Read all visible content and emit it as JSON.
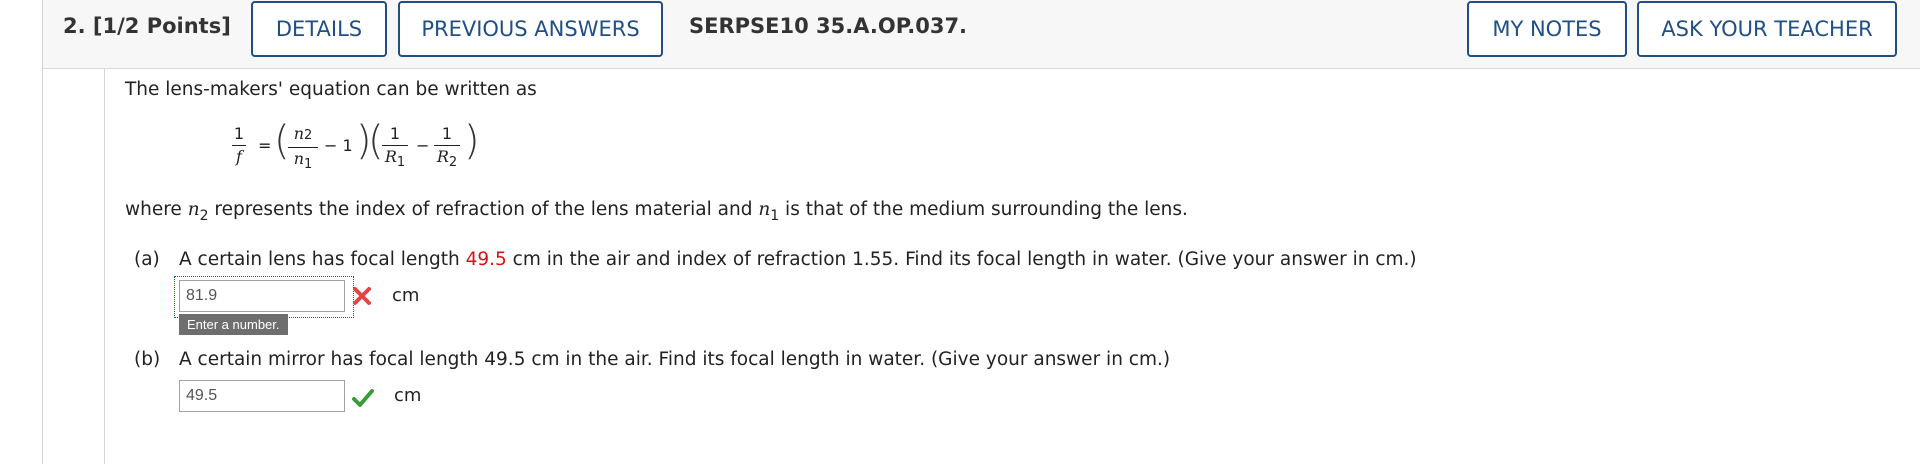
{
  "question": {
    "number_label": "2.",
    "points_label": "[1/2 Points]",
    "details_button": "DETAILS",
    "previous_answers_button": "PREVIOUS ANSWERS",
    "assignment_id": "SERPSE10 35.A.OP.037.",
    "my_notes_button": "MY NOTES",
    "ask_teacher_button": "ASK YOUR TEACHER"
  },
  "body": {
    "intro": "The lens-makers' equation can be written as",
    "equation": {
      "lhs_num": "1",
      "lhs_den": "f",
      "equals": "=",
      "n2": "n",
      "n2_sub": "2",
      "n1": "n",
      "n1_sub": "1",
      "minus_one": "− 1",
      "r1_num": "1",
      "r1_den": "R",
      "r1_sub": "1",
      "minus": "−",
      "r2_num": "1",
      "r2_den": "R",
      "r2_sub": "2",
      "lparen": "(",
      "rparen": ")"
    },
    "where_prefix": "where ",
    "where_n2": "n",
    "where_n2_sub": "2",
    "where_mid": " represents the index of refraction of the lens material and ",
    "where_n1": "n",
    "where_n1_sub": "1",
    "where_suffix": " is that of the medium surrounding the lens."
  },
  "part_a": {
    "label": "(a)",
    "text_before": "A certain lens has focal length ",
    "highlight_value": "49.5",
    "text_after": " cm in the air and index of refraction 1.55. Find its focal length in water. (Give your answer in cm.)",
    "input_value": "81.9",
    "status": "incorrect",
    "status_icon": "x-icon",
    "status_color": "#e64444",
    "unit": "cm",
    "tooltip": "Enter a number."
  },
  "part_b": {
    "label": "(b)",
    "text": "A certain mirror has focal length 49.5 cm in the air. Find its focal length in water. (Give your answer in cm.)",
    "input_value": "49.5",
    "status": "correct",
    "status_icon": "checkmark-icon",
    "status_color": "#3a9d3a",
    "unit": "cm"
  },
  "colors": {
    "accent": "#1f4f86",
    "highlight": "#e01010",
    "header_bg": "#f7f7f7"
  }
}
